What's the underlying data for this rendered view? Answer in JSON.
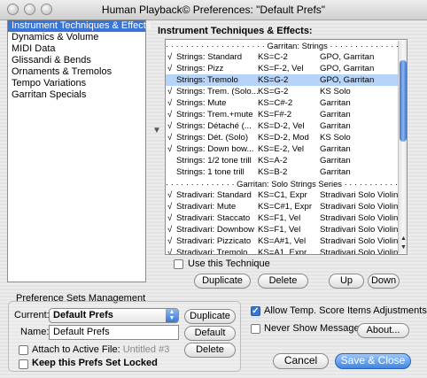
{
  "window": {
    "title": "Human Playback© Preferences: \"Default Prefs\""
  },
  "categories": [
    "Instrument Techniques & Effects",
    "Dynamics & Volume",
    "MIDI Data",
    "Glissandi & Bends",
    "Ornaments & Tremolos",
    "Tempo Variations",
    "Garritan Specials"
  ],
  "techniques": {
    "label": "Instrument Techniques & Effects:",
    "rows": [
      {
        "type": "sep",
        "text": "· · · · · · · · · · · · · · · · · · · · Garritan: Strings · · · · · · · · · · · · · · · · · · · ·"
      },
      {
        "check": "√",
        "name": "Strings: Standard",
        "ks": "KS=C-2",
        "lib": "GPO, Garritan"
      },
      {
        "check": "√",
        "name": "Strings: Pizz",
        "ks": "KS=F-2, Vel",
        "lib": "GPO, Garritan"
      },
      {
        "check": "",
        "name": "Strings: Tremolo",
        "ks": "KS=G-2",
        "lib": "GPO, Garritan",
        "selected": true
      },
      {
        "check": "√",
        "name": "Strings: Trem. (Solo...",
        "ks": "KS=G-2",
        "lib": "KS Solo"
      },
      {
        "check": "√",
        "name": "Strings: Mute",
        "ks": "KS=C#-2",
        "lib": "Garritan"
      },
      {
        "check": "√",
        "name": "Strings: Trem.+mute",
        "ks": "KS=F#-2",
        "lib": "Garritan"
      },
      {
        "check": "√",
        "name": "Strings: Détaché (...",
        "ks": "KS=D-2, Vel",
        "lib": "Garritan"
      },
      {
        "check": "√",
        "name": "Strings: Dét. (Solo)",
        "ks": "KS=D-2, Mod",
        "lib": "KS Solo"
      },
      {
        "check": "√",
        "name": "Strings: Down bow...",
        "ks": "KS=E-2, Vel",
        "lib": "Garritan"
      },
      {
        "check": "",
        "name": "Strings: 1/2 tone trill",
        "ks": "KS=A-2",
        "lib": "Garritan"
      },
      {
        "check": "",
        "name": "Strings: 1 tone trill",
        "ks": "KS=B-2",
        "lib": "Garritan"
      },
      {
        "type": "sep",
        "text": "· · · · · · · · · · · · · · Garritan: Solo Strings Series · · · · · · · · · · · · · ·"
      },
      {
        "check": "√",
        "name": "Stradivari: Standard",
        "ks": "KS=C1, Expr",
        "lib": "Stradivari Solo Violin"
      },
      {
        "check": "√",
        "name": "Stradivari: Mute",
        "ks": "KS=C#1, Expr",
        "lib": "Stradivari Solo Violin"
      },
      {
        "check": "√",
        "name": "Stradivari: Staccato",
        "ks": "KS=F1, Vel",
        "lib": "Stradivari Solo Violin"
      },
      {
        "check": "√",
        "name": "Stradivari: Downbow",
        "ks": "KS=F1, Vel",
        "lib": "Stradivari Solo Violin"
      },
      {
        "check": "√",
        "name": "Stradivari: Pizzicato",
        "ks": "KS=A#1, Vel",
        "lib": "Stradivari Solo Violin"
      },
      {
        "check": "√",
        "name": "Stradivari: Tremolo",
        "ks": "KS=A1, Expr",
        "lib": "Stradivari Solo Violin"
      }
    ],
    "use_label": "Use this Technique",
    "duplicate": "Duplicate",
    "delete": "Delete",
    "up": "Up",
    "down": "Down"
  },
  "sets": {
    "title": "Preference Sets Management",
    "current_label": "Current:",
    "current_value": "Default Prefs",
    "name_label": "Name:",
    "name_value": "Default Prefs",
    "attach_label": "Attach to Active File:",
    "attach_file": "Untitled #3",
    "keep_label": "Keep this Prefs Set Locked",
    "duplicate": "Duplicate",
    "default": "Default",
    "delete": "Delete"
  },
  "options": {
    "allow_temp": "Allow Temp. Score Items Adjustments",
    "allow_temp_checked": true,
    "never_show": "Never Show Messages",
    "never_show_checked": false,
    "about": "About..."
  },
  "footer": {
    "cancel": "Cancel",
    "save": "Save & Close"
  },
  "icons": [
    "close-light-icon",
    "minimize-light-icon",
    "zoom-light-icon",
    "triangle-down-icon",
    "scroll-up-arrow-icon",
    "scroll-down-arrow-icon",
    "popup-arrows-icon",
    "checkmark-icon"
  ]
}
